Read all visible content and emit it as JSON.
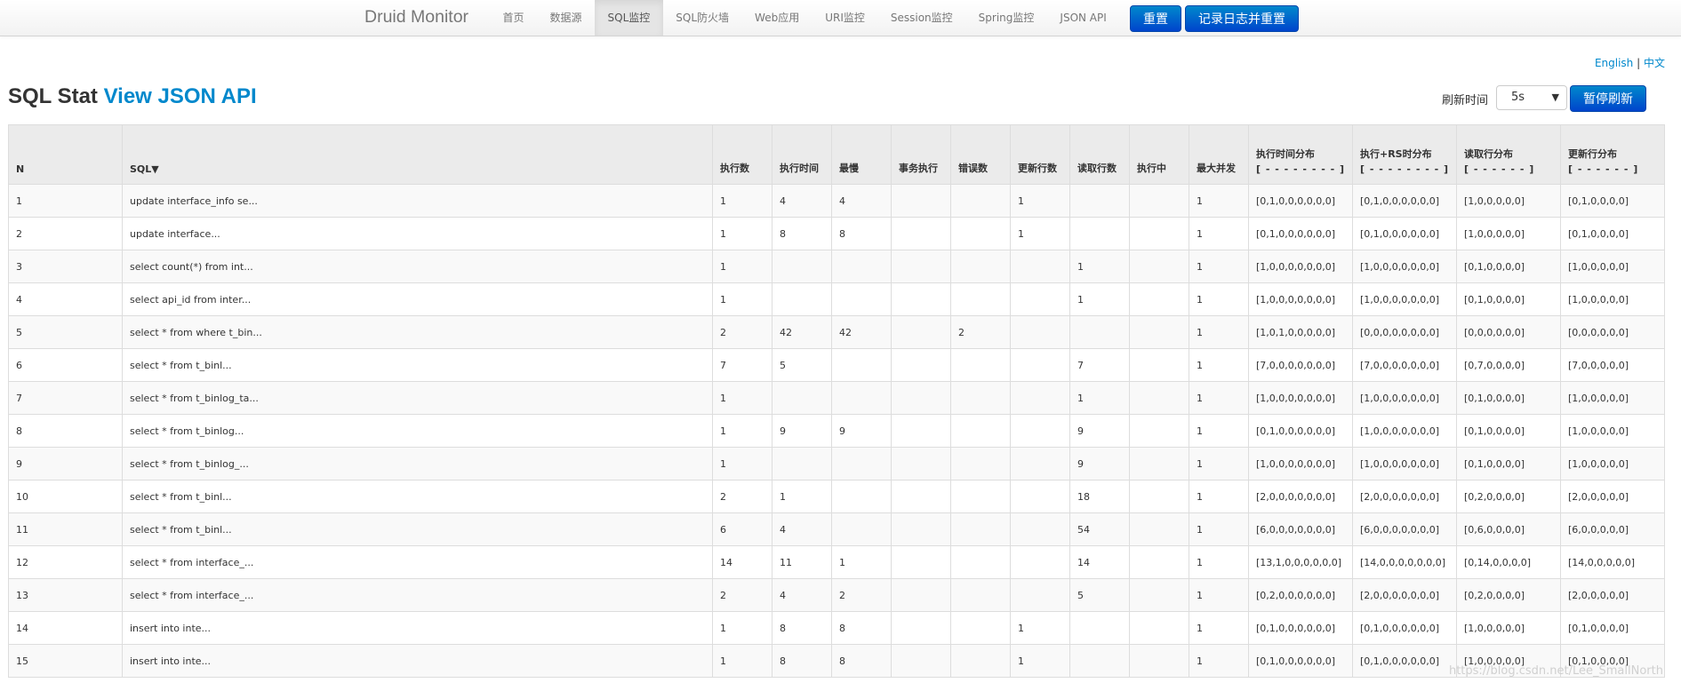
{
  "header": {
    "brand": "Druid Monitor",
    "nav": [
      "首页",
      "数据源",
      "SQL监控",
      "SQL防火墙",
      "Web应用",
      "URI监控",
      "Session监控",
      "Spring监控",
      "JSON API"
    ],
    "reset_label": "重置",
    "log_reset_label": "记录日志并重置"
  },
  "lang": {
    "english": "English",
    "sep": "|",
    "chinese": "中文"
  },
  "page": {
    "title": "SQL Stat",
    "json_link": "View JSON API"
  },
  "refresh": {
    "label": "刷新时间",
    "value": "5s",
    "pause_label": "暂停刷新"
  },
  "table": {
    "headers": {
      "n": "N",
      "sql": "SQL▼",
      "exec": "执行数",
      "time": "执行时间",
      "slowest": "最慢",
      "tx": "事务执行",
      "err": "错误数",
      "update": "更新行数",
      "fetch": "读取行数",
      "running": "执行中",
      "concurrent": "最大并发",
      "hist": "执行时间分布",
      "hist_sub": "[ - - - - - - - - ]",
      "rs_hist": "执行+RS时分布",
      "rs_hist_sub": "[ - - - - - - - - ]",
      "fetch_hist": "读取行分布",
      "fetch_hist_sub": "[ - - - - - - ]",
      "update_hist": "更新行分布",
      "update_hist_sub": "[ - - - - - - ]"
    },
    "rows": [
      [
        "1",
        "update interface_info se...",
        "1",
        "4",
        "4",
        "",
        "",
        "1",
        "",
        "",
        "1",
        "[0,1,0,0,0,0,0,0]",
        "[0,1,0,0,0,0,0,0]",
        "[1,0,0,0,0,0]",
        "[0,1,0,0,0,0]"
      ],
      [
        "2",
        "update interface...",
        "1",
        "8",
        "8",
        "",
        "",
        "1",
        "",
        "",
        "1",
        "[0,1,0,0,0,0,0,0]",
        "[0,1,0,0,0,0,0,0]",
        "[1,0,0,0,0,0]",
        "[0,1,0,0,0,0]"
      ],
      [
        "3",
        "select count(*) from int...",
        "1",
        "",
        "",
        "",
        "",
        "",
        "1",
        "",
        "1",
        "[1,0,0,0,0,0,0,0]",
        "[1,0,0,0,0,0,0,0]",
        "[0,1,0,0,0,0]",
        "[1,0,0,0,0,0]"
      ],
      [
        "4",
        "select api_id from inter...",
        "1",
        "",
        "",
        "",
        "",
        "",
        "1",
        "",
        "1",
        "[1,0,0,0,0,0,0,0]",
        "[1,0,0,0,0,0,0,0]",
        "[0,1,0,0,0,0]",
        "[1,0,0,0,0,0]"
      ],
      [
        "5",
        "select * from where t_bin...",
        "2",
        "42",
        "42",
        "",
        "2",
        "",
        "",
        "",
        "1",
        "[1,0,1,0,0,0,0,0]",
        "[0,0,0,0,0,0,0,0]",
        "[0,0,0,0,0,0]",
        "[0,0,0,0,0,0]"
      ],
      [
        "6",
        "select * from t_binl...",
        "7",
        "5",
        "",
        "",
        "",
        "",
        "7",
        "",
        "1",
        "[7,0,0,0,0,0,0,0]",
        "[7,0,0,0,0,0,0,0]",
        "[0,7,0,0,0,0]",
        "[7,0,0,0,0,0]"
      ],
      [
        "7",
        "select * from t_binlog_ta...",
        "1",
        "",
        "",
        "",
        "",
        "",
        "1",
        "",
        "1",
        "[1,0,0,0,0,0,0,0]",
        "[1,0,0,0,0,0,0,0]",
        "[0,1,0,0,0,0]",
        "[1,0,0,0,0,0]"
      ],
      [
        "8",
        "select * from t_binlog...",
        "1",
        "9",
        "9",
        "",
        "",
        "",
        "9",
        "",
        "1",
        "[0,1,0,0,0,0,0,0]",
        "[1,0,0,0,0,0,0,0]",
        "[0,1,0,0,0,0]",
        "[1,0,0,0,0,0]"
      ],
      [
        "9",
        "select * from t_binlog_...",
        "1",
        "",
        "",
        "",
        "",
        "",
        "9",
        "",
        "1",
        "[1,0,0,0,0,0,0,0]",
        "[1,0,0,0,0,0,0,0]",
        "[0,1,0,0,0,0]",
        "[1,0,0,0,0,0]"
      ],
      [
        "10",
        "select * from t_binl...",
        "2",
        "1",
        "",
        "",
        "",
        "",
        "18",
        "",
        "1",
        "[2,0,0,0,0,0,0,0]",
        "[2,0,0,0,0,0,0,0]",
        "[0,2,0,0,0,0]",
        "[2,0,0,0,0,0]"
      ],
      [
        "11",
        "select * from t_binl...",
        "6",
        "4",
        "",
        "",
        "",
        "",
        "54",
        "",
        "1",
        "[6,0,0,0,0,0,0,0]",
        "[6,0,0,0,0,0,0,0]",
        "[0,6,0,0,0,0]",
        "[6,0,0,0,0,0]"
      ],
      [
        "12",
        "select * from interface_...",
        "14",
        "11",
        "1",
        "",
        "",
        "",
        "14",
        "",
        "1",
        "[13,1,0,0,0,0,0,0]",
        "[14,0,0,0,0,0,0,0]",
        "[0,14,0,0,0,0]",
        "[14,0,0,0,0,0]"
      ],
      [
        "13",
        "select * from interface_...",
        "2",
        "4",
        "2",
        "",
        "",
        "",
        "5",
        "",
        "1",
        "[0,2,0,0,0,0,0,0]",
        "[2,0,0,0,0,0,0,0]",
        "[0,2,0,0,0,0]",
        "[2,0,0,0,0,0]"
      ],
      [
        "14",
        "insert into inte...",
        "1",
        "8",
        "8",
        "",
        "",
        "1",
        "",
        "",
        "1",
        "[0,1,0,0,0,0,0,0]",
        "[0,1,0,0,0,0,0,0]",
        "[1,0,0,0,0,0]",
        "[0,1,0,0,0,0]"
      ],
      [
        "15",
        "insert into inte...",
        "1",
        "8",
        "8",
        "",
        "",
        "1",
        "",
        "",
        "1",
        "[0,1,0,0,0,0,0,0]",
        "[0,1,0,0,0,0,0,0]",
        "[1,0,0,0,0,0]",
        "[0,1,0,0,0,0]"
      ]
    ]
  },
  "watermark": "https://blog.csdn.net/Lee_SmallNorth",
  "colors": {
    "accent": "#0088cc",
    "slow": "#e01b1b",
    "header_bg": "#ebebeb"
  }
}
